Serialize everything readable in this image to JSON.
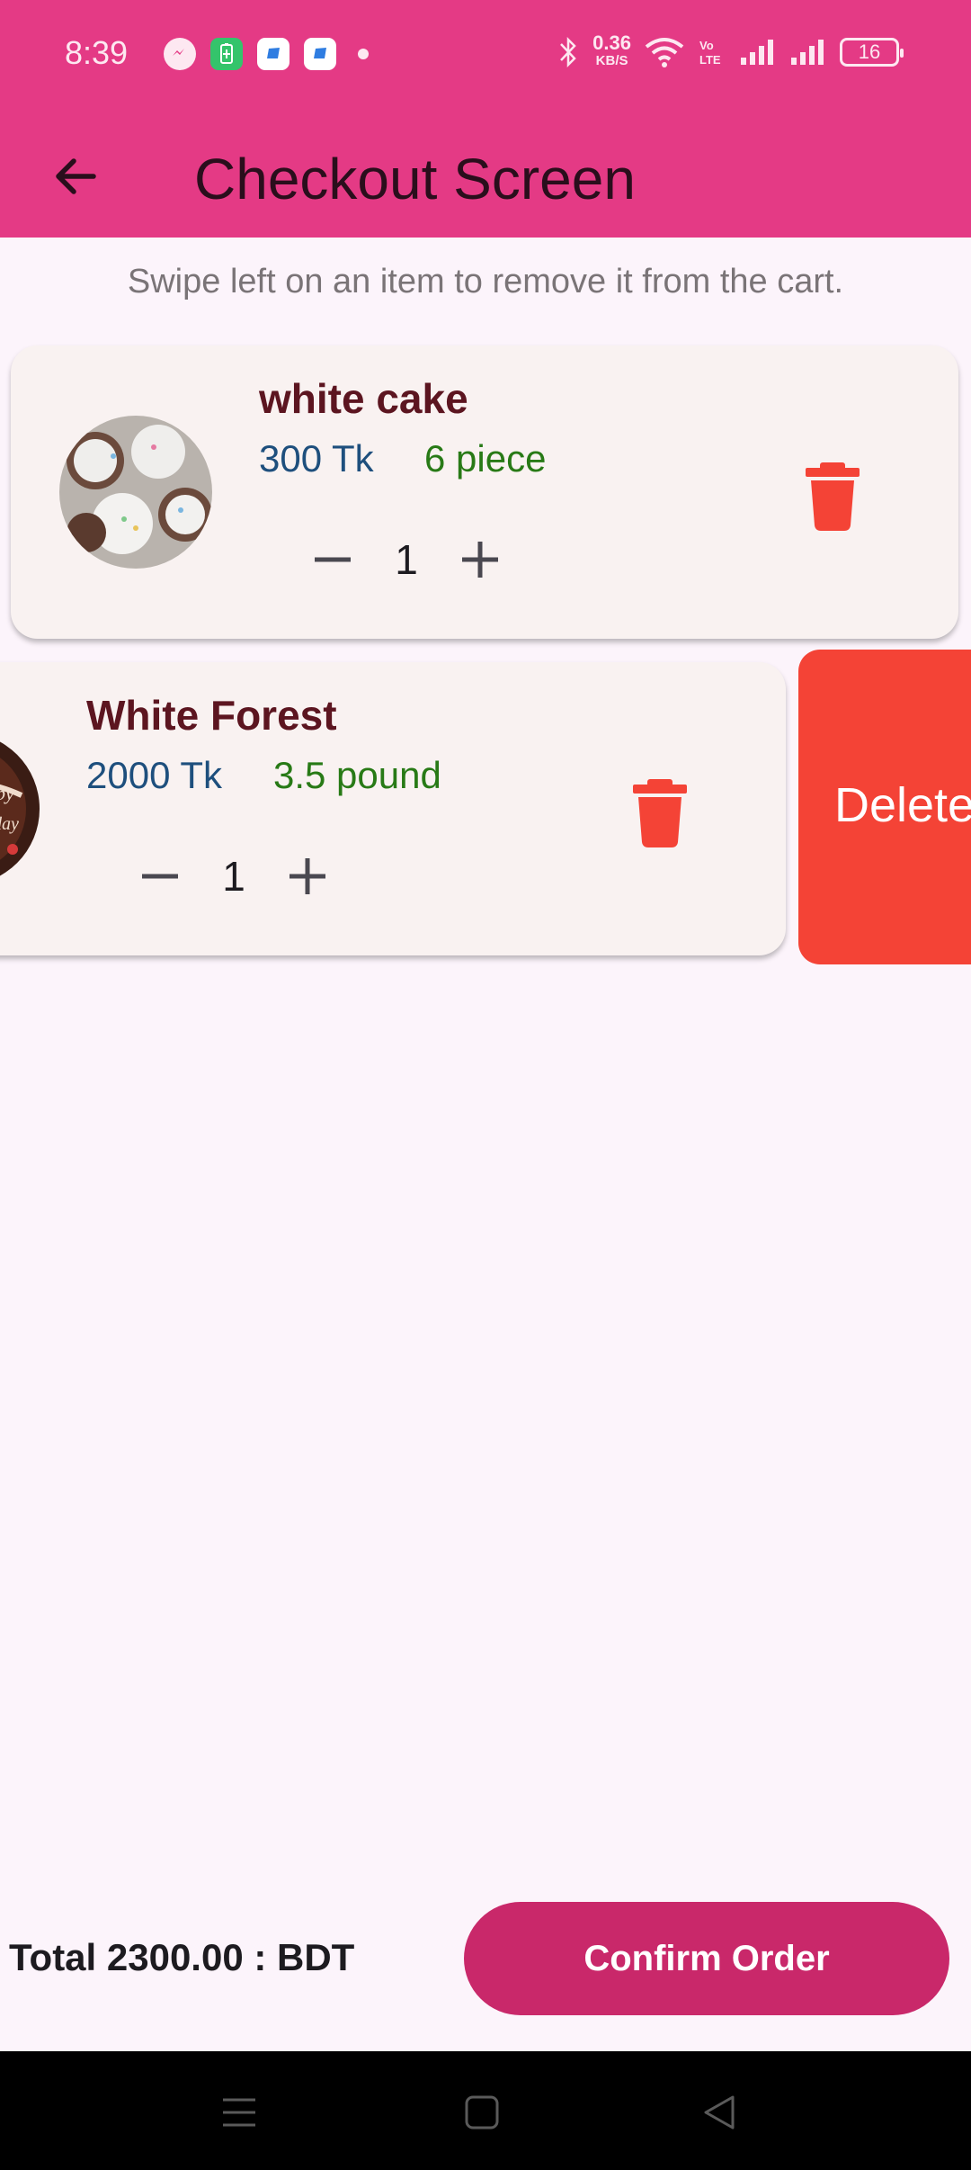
{
  "status_bar": {
    "time": "8:39",
    "speed_value": "0.36",
    "speed_unit": "KB/S",
    "battery_level": "16"
  },
  "app_bar": {
    "title": "Checkout Screen",
    "back_icon": "arrow-back-icon"
  },
  "hint": "Swipe left on an item to remove it from the cart.",
  "cart_items": [
    {
      "name": "white cake",
      "price": "300 Tk",
      "size": "6 piece",
      "quantity": "1",
      "minus": "−",
      "plus": "+"
    },
    {
      "name": "White Forest",
      "price": "2000 Tk",
      "size": "3.5 pound",
      "quantity": "1",
      "minus": "−",
      "plus": "+"
    }
  ],
  "swipe_action": {
    "label": "Delete"
  },
  "footer": {
    "total": "Total 2300.00 : BDT",
    "confirm_label": "Confirm Order"
  },
  "colors": {
    "app_bar": "#e43a85",
    "confirm": "#c9286a",
    "delete": "#f44336",
    "item_name": "#5c1520",
    "price": "#1e4f7d",
    "size": "#287a16"
  }
}
